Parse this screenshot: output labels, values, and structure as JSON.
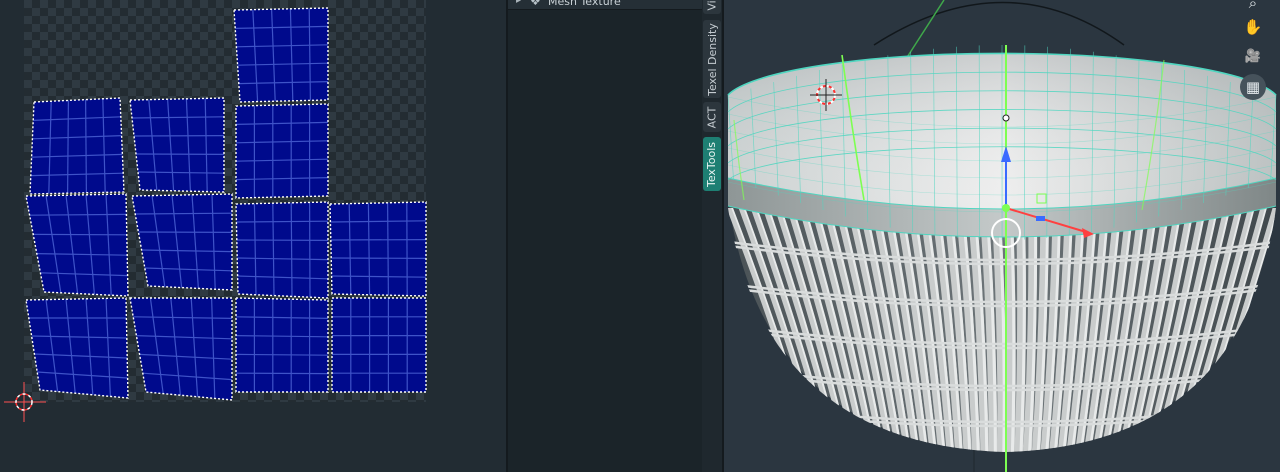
{
  "side_panel": {
    "header_title": "Mesh Texture",
    "expand_arrow": "▸",
    "mesh_icon": "❖",
    "more_dots": "···"
  },
  "tabs": [
    {
      "label": "Vi",
      "active": false
    },
    {
      "label": "Texel Density",
      "active": false
    },
    {
      "label": "ACT",
      "active": false
    },
    {
      "label": "TexTools",
      "active": true
    }
  ],
  "viewport_tools": [
    {
      "icon": "search-icon",
      "glyph": "⌕"
    },
    {
      "icon": "hand-pan-icon",
      "glyph": "✋"
    },
    {
      "icon": "camera-icon",
      "glyph": "🎥"
    },
    {
      "icon": "grid-icon",
      "glyph": "▦"
    }
  ],
  "colors": {
    "uv_face": "#000a8c",
    "uv_edge": "#ffffff",
    "wire": "#4fd6c0",
    "seam": "#7dff52",
    "axis_x": "#ff4040",
    "axis_y": "#3a6bff",
    "axis_z": "#3a6bff",
    "active_tab": "#1e7f73"
  }
}
